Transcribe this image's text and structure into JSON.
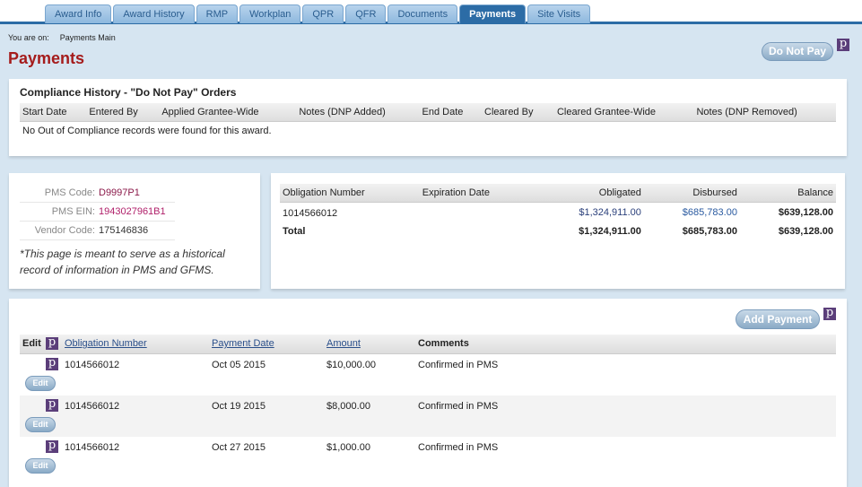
{
  "tabs": [
    {
      "label": "Award Info"
    },
    {
      "label": "Award History"
    },
    {
      "label": "RMP"
    },
    {
      "label": "Workplan"
    },
    {
      "label": "QPR"
    },
    {
      "label": "QFR"
    },
    {
      "label": "Documents"
    },
    {
      "label": "Payments",
      "active": true
    },
    {
      "label": "Site Visits"
    }
  ],
  "breadcrumb": {
    "prefix": "You are on:",
    "current": "Payments Main"
  },
  "title": "Payments",
  "do_not_pay": "Do Not Pay",
  "p_icon": "p",
  "compliance": {
    "title": "Compliance History - \"Do Not Pay\" Orders",
    "headers": [
      "Start Date",
      "Entered By",
      "Applied Grantee-Wide",
      "Notes (DNP Added)",
      "End Date",
      "Cleared By",
      "Cleared Grantee-Wide",
      "Notes (DNP Removed)"
    ],
    "empty": "No Out of Compliance records were found for this award."
  },
  "info": {
    "pms_code_label": "PMS Code:",
    "pms_code": "D9997P1",
    "pms_ein_label": "PMS EIN:",
    "pms_ein": "1943027961B1",
    "vendor_label": "Vendor Code:",
    "vendor": "175146836",
    "note": "*This page is meant to serve as a historical record of information in PMS and GFMS."
  },
  "obligations": {
    "headers": [
      "Obligation Number",
      "Expiration Date",
      "Obligated",
      "Disbursed",
      "Balance"
    ],
    "row": {
      "number": "1014566012",
      "expiration": "",
      "obligated": "$1,324,911.00",
      "disbursed": "$685,783.00",
      "balance": "$639,128.00"
    },
    "total": {
      "label": "Total",
      "obligated": "$1,324,911.00",
      "disbursed": "$685,783.00",
      "balance": "$639,128.00"
    }
  },
  "payments": {
    "add_label": "Add Payment",
    "headers": {
      "edit": "Edit",
      "obligation": "Obligation Number",
      "date": "Payment Date",
      "amount": "Amount",
      "comments": "Comments"
    },
    "edit_label": "Edit",
    "rows": [
      {
        "obligation": "1014566012",
        "date": "Oct 05 2015",
        "amount": "$10,000.00",
        "comments": "Confirmed in PMS"
      },
      {
        "obligation": "1014566012",
        "date": "Oct 19 2015",
        "amount": "$8,000.00",
        "comments": "Confirmed in PMS"
      },
      {
        "obligation": "1014566012",
        "date": "Oct 27 2015",
        "amount": "$1,000.00",
        "comments": "Confirmed in PMS"
      }
    ]
  }
}
